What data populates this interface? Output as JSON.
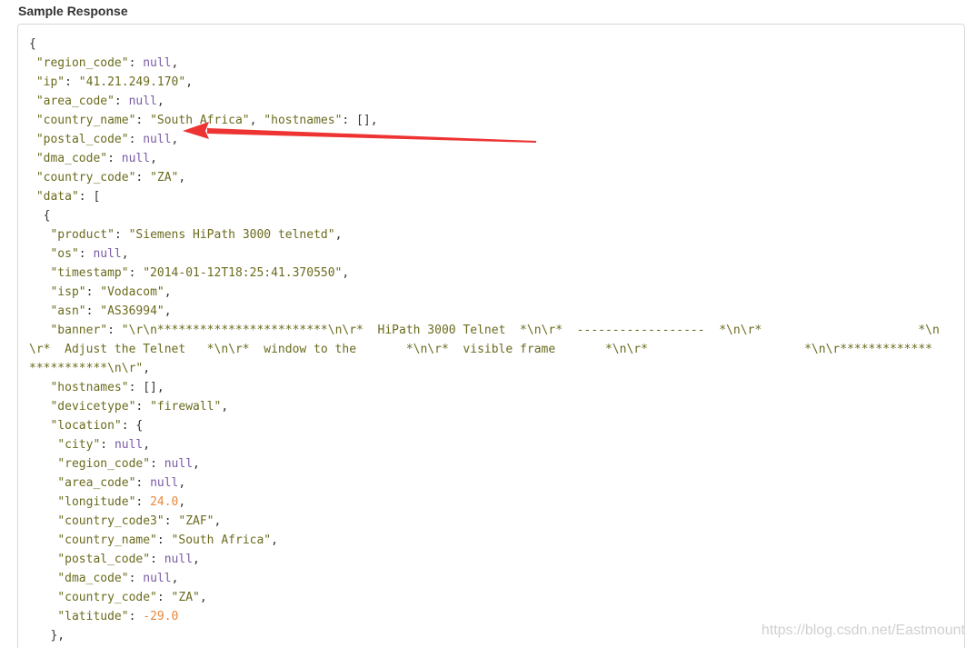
{
  "section": {
    "title": "Sample Response"
  },
  "code": {
    "lines": [
      [
        [
          "p",
          "{"
        ]
      ],
      [
        [
          "p",
          " "
        ],
        [
          "s",
          "\"region_code\""
        ],
        [
          "p",
          ": "
        ],
        [
          "n",
          "null"
        ],
        [
          "p",
          ","
        ]
      ],
      [
        [
          "p",
          " "
        ],
        [
          "s",
          "\"ip\""
        ],
        [
          "p",
          ": "
        ],
        [
          "s",
          "\"41.21.249.170\""
        ],
        [
          "p",
          ","
        ]
      ],
      [
        [
          "p",
          " "
        ],
        [
          "s",
          "\"area_code\""
        ],
        [
          "p",
          ": "
        ],
        [
          "n",
          "null"
        ],
        [
          "p",
          ","
        ]
      ],
      [
        [
          "p",
          " "
        ],
        [
          "s",
          "\"country_name\""
        ],
        [
          "p",
          ": "
        ],
        [
          "s",
          "\"South Africa\""
        ],
        [
          "p",
          ", "
        ],
        [
          "s",
          "\"hostnames\""
        ],
        [
          "p",
          ": [],"
        ]
      ],
      [
        [
          "p",
          " "
        ],
        [
          "s",
          "\"postal_code\""
        ],
        [
          "p",
          ": "
        ],
        [
          "n",
          "null"
        ],
        [
          "p",
          ","
        ]
      ],
      [
        [
          "p",
          " "
        ],
        [
          "s",
          "\"dma_code\""
        ],
        [
          "p",
          ": "
        ],
        [
          "n",
          "null"
        ],
        [
          "p",
          ","
        ]
      ],
      [
        [
          "p",
          " "
        ],
        [
          "s",
          "\"country_code\""
        ],
        [
          "p",
          ": "
        ],
        [
          "s",
          "\"ZA\""
        ],
        [
          "p",
          ","
        ]
      ],
      [
        [
          "p",
          " "
        ],
        [
          "s",
          "\"data\""
        ],
        [
          "p",
          ": ["
        ]
      ],
      [
        [
          "p",
          "  {"
        ]
      ],
      [
        [
          "p",
          "   "
        ],
        [
          "s",
          "\"product\""
        ],
        [
          "p",
          ": "
        ],
        [
          "s",
          "\"Siemens HiPath 3000 telnetd\""
        ],
        [
          "p",
          ","
        ]
      ],
      [
        [
          "p",
          "   "
        ],
        [
          "s",
          "\"os\""
        ],
        [
          "p",
          ": "
        ],
        [
          "n",
          "null"
        ],
        [
          "p",
          ","
        ]
      ],
      [
        [
          "p",
          "   "
        ],
        [
          "s",
          "\"timestamp\""
        ],
        [
          "p",
          ": "
        ],
        [
          "s",
          "\"2014-01-12T18:25:41.370550\""
        ],
        [
          "p",
          ","
        ]
      ],
      [
        [
          "p",
          "   "
        ],
        [
          "s",
          "\"isp\""
        ],
        [
          "p",
          ": "
        ],
        [
          "s",
          "\"Vodacom\""
        ],
        [
          "p",
          ","
        ]
      ],
      [
        [
          "p",
          "   "
        ],
        [
          "s",
          "\"asn\""
        ],
        [
          "p",
          ": "
        ],
        [
          "s",
          "\"AS36994\""
        ],
        [
          "p",
          ","
        ]
      ],
      [
        [
          "p",
          "   "
        ],
        [
          "s",
          "\"banner\""
        ],
        [
          "p",
          ": "
        ],
        [
          "s",
          "\"\\r\\n************************\\n\\r*  HiPath 3000 Telnet  *\\n\\r*  ------------------  *\\n\\r*                      *\\n"
        ]
      ],
      [
        [
          "s",
          "\\r*  Adjust the Telnet   *\\n\\r*  window to the       *\\n\\r*  visible frame       *\\n\\r*                      *\\n\\r*************"
        ]
      ],
      [
        [
          "s",
          "***********\\n\\r\""
        ],
        [
          "p",
          ","
        ]
      ],
      [
        [
          "p",
          "   "
        ],
        [
          "s",
          "\"hostnames\""
        ],
        [
          "p",
          ": [],"
        ]
      ],
      [
        [
          "p",
          "   "
        ],
        [
          "s",
          "\"devicetype\""
        ],
        [
          "p",
          ": "
        ],
        [
          "s",
          "\"firewall\""
        ],
        [
          "p",
          ","
        ]
      ],
      [
        [
          "p",
          "   "
        ],
        [
          "s",
          "\"location\""
        ],
        [
          "p",
          ": {"
        ]
      ],
      [
        [
          "p",
          "    "
        ],
        [
          "s",
          "\"city\""
        ],
        [
          "p",
          ": "
        ],
        [
          "n",
          "null"
        ],
        [
          "p",
          ","
        ]
      ],
      [
        [
          "p",
          "    "
        ],
        [
          "s",
          "\"region_code\""
        ],
        [
          "p",
          ": "
        ],
        [
          "n",
          "null"
        ],
        [
          "p",
          ","
        ]
      ],
      [
        [
          "p",
          "    "
        ],
        [
          "s",
          "\"area_code\""
        ],
        [
          "p",
          ": "
        ],
        [
          "n",
          "null"
        ],
        [
          "p",
          ","
        ]
      ],
      [
        [
          "p",
          "    "
        ],
        [
          "s",
          "\"longitude\""
        ],
        [
          "p",
          ": "
        ],
        [
          "num",
          "24.0"
        ],
        [
          "p",
          ","
        ]
      ],
      [
        [
          "p",
          "    "
        ],
        [
          "s",
          "\"country_code3\""
        ],
        [
          "p",
          ": "
        ],
        [
          "s",
          "\"ZAF\""
        ],
        [
          "p",
          ","
        ]
      ],
      [
        [
          "p",
          "    "
        ],
        [
          "s",
          "\"country_name\""
        ],
        [
          "p",
          ": "
        ],
        [
          "s",
          "\"South Africa\""
        ],
        [
          "p",
          ","
        ]
      ],
      [
        [
          "p",
          "    "
        ],
        [
          "s",
          "\"postal_code\""
        ],
        [
          "p",
          ": "
        ],
        [
          "n",
          "null"
        ],
        [
          "p",
          ","
        ]
      ],
      [
        [
          "p",
          "    "
        ],
        [
          "s",
          "\"dma_code\""
        ],
        [
          "p",
          ": "
        ],
        [
          "n",
          "null"
        ],
        [
          "p",
          ","
        ]
      ],
      [
        [
          "p",
          "    "
        ],
        [
          "s",
          "\"country_code\""
        ],
        [
          "p",
          ": "
        ],
        [
          "s",
          "\"ZA\""
        ],
        [
          "p",
          ","
        ]
      ],
      [
        [
          "p",
          "    "
        ],
        [
          "s",
          "\"latitude\""
        ],
        [
          "p",
          ": "
        ],
        [
          "num",
          "-29.0"
        ]
      ],
      [
        [
          "p",
          "   },"
        ]
      ]
    ]
  },
  "annotation": {
    "type": "red-arrow",
    "color": "#ee3333"
  },
  "watermark": {
    "text": "https://blog.csdn.net/Eastmount"
  },
  "colors": {
    "string": "#6b6b1f",
    "null": "#7a5aa6",
    "number": "#e8883a",
    "punct": "#333333"
  }
}
